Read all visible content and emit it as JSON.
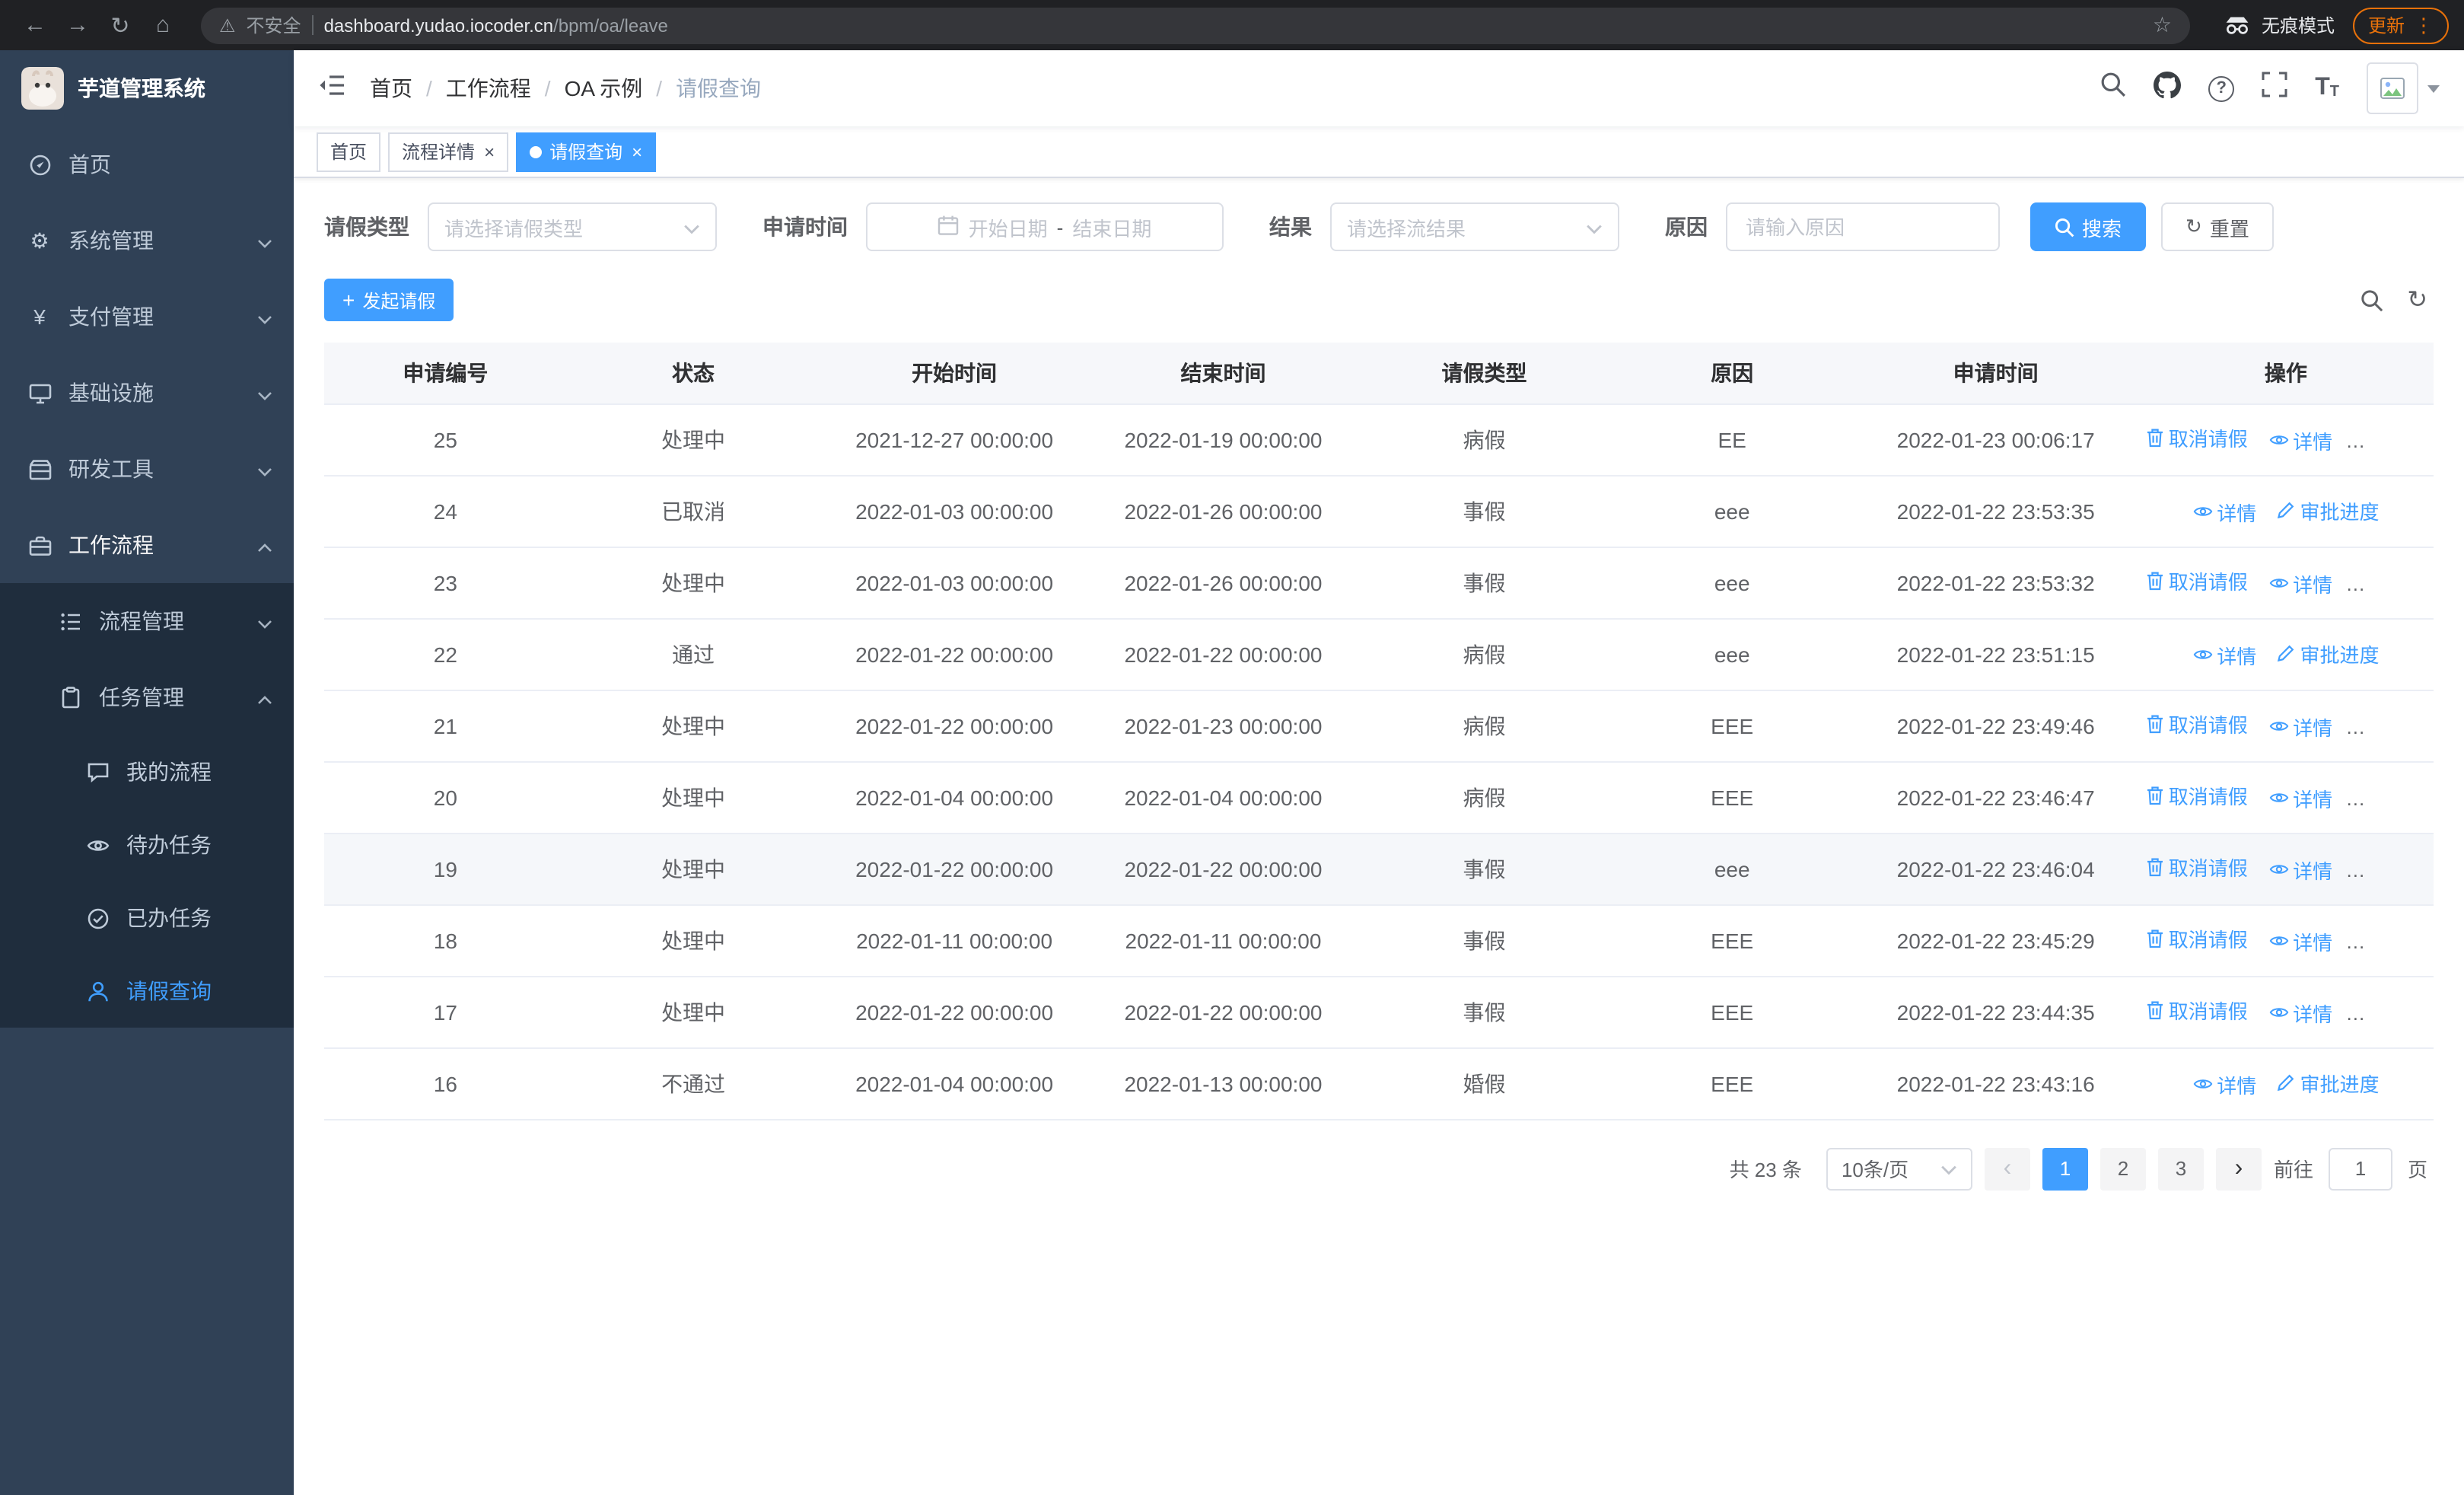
{
  "browser": {
    "security_label": "不安全",
    "url_host": "dashboard.yudao.iocoder.cn",
    "url_path": "/bpm/oa/leave",
    "incognito_label": "无痕模式",
    "update_label": "更新"
  },
  "sidebar": {
    "title": "芋道管理系统",
    "items": [
      {
        "label": "首页"
      },
      {
        "label": "系统管理"
      },
      {
        "label": "支付管理"
      },
      {
        "label": "基础设施"
      },
      {
        "label": "研发工具"
      },
      {
        "label": "工作流程"
      },
      {
        "label": "流程管理"
      },
      {
        "label": "任务管理"
      },
      {
        "label": "我的流程"
      },
      {
        "label": "待办任务"
      },
      {
        "label": "已办任务"
      },
      {
        "label": "请假查询"
      }
    ]
  },
  "breadcrumb": [
    "首页",
    "工作流程",
    "OA 示例",
    "请假查询"
  ],
  "tabs": [
    {
      "label": "首页"
    },
    {
      "label": "流程详情"
    },
    {
      "label": "请假查询"
    }
  ],
  "filter": {
    "leave_type_label": "请假类型",
    "leave_type_placeholder": "请选择请假类型",
    "apply_time_label": "申请时间",
    "start_placeholder": "开始日期",
    "separator": "-",
    "end_placeholder": "结束日期",
    "result_label": "结果",
    "result_placeholder": "请选择流结果",
    "reason_label": "原因",
    "reason_placeholder": "请输入原因",
    "search_label": "搜索",
    "reset_label": "重置"
  },
  "toolbar": {
    "create_label": "发起请假"
  },
  "table": {
    "columns": [
      "申请编号",
      "状态",
      "开始时间",
      "结束时间",
      "请假类型",
      "原因",
      "申请时间",
      "操作"
    ],
    "ops": {
      "cancel": "取消请假",
      "detail": "详情",
      "progress": "审批进度"
    },
    "rows": [
      {
        "id": "25",
        "status": "处理中",
        "start": "2021-12-27 00:00:00",
        "end": "2022-01-19 00:00:00",
        "type": "病假",
        "reason": "EE",
        "apply": "2022-01-23 00:06:17",
        "can_cancel": true,
        "highlight": false
      },
      {
        "id": "24",
        "status": "已取消",
        "start": "2022-01-03 00:00:00",
        "end": "2022-01-26 00:00:00",
        "type": "事假",
        "reason": "eee",
        "apply": "2022-01-22 23:53:35",
        "can_cancel": false,
        "highlight": false
      },
      {
        "id": "23",
        "status": "处理中",
        "start": "2022-01-03 00:00:00",
        "end": "2022-01-26 00:00:00",
        "type": "事假",
        "reason": "eee",
        "apply": "2022-01-22 23:53:32",
        "can_cancel": true,
        "highlight": false
      },
      {
        "id": "22",
        "status": "通过",
        "start": "2022-01-22 00:00:00",
        "end": "2022-01-22 00:00:00",
        "type": "病假",
        "reason": "eee",
        "apply": "2022-01-22 23:51:15",
        "can_cancel": false,
        "highlight": false
      },
      {
        "id": "21",
        "status": "处理中",
        "start": "2022-01-22 00:00:00",
        "end": "2022-01-23 00:00:00",
        "type": "病假",
        "reason": "EEE",
        "apply": "2022-01-22 23:49:46",
        "can_cancel": true,
        "highlight": false
      },
      {
        "id": "20",
        "status": "处理中",
        "start": "2022-01-04 00:00:00",
        "end": "2022-01-04 00:00:00",
        "type": "病假",
        "reason": "EEE",
        "apply": "2022-01-22 23:46:47",
        "can_cancel": true,
        "highlight": false
      },
      {
        "id": "19",
        "status": "处理中",
        "start": "2022-01-22 00:00:00",
        "end": "2022-01-22 00:00:00",
        "type": "事假",
        "reason": "eee",
        "apply": "2022-01-22 23:46:04",
        "can_cancel": true,
        "highlight": true
      },
      {
        "id": "18",
        "status": "处理中",
        "start": "2022-01-11 00:00:00",
        "end": "2022-01-11 00:00:00",
        "type": "事假",
        "reason": "EEE",
        "apply": "2022-01-22 23:45:29",
        "can_cancel": true,
        "highlight": false
      },
      {
        "id": "17",
        "status": "处理中",
        "start": "2022-01-22 00:00:00",
        "end": "2022-01-22 00:00:00",
        "type": "事假",
        "reason": "EEE",
        "apply": "2022-01-22 23:44:35",
        "can_cancel": true,
        "highlight": false
      },
      {
        "id": "16",
        "status": "不通过",
        "start": "2022-01-04 00:00:00",
        "end": "2022-01-13 00:00:00",
        "type": "婚假",
        "reason": "EEE",
        "apply": "2022-01-22 23:43:16",
        "can_cancel": false,
        "highlight": false
      }
    ]
  },
  "pagination": {
    "total": "共 23 条",
    "page_size": "10条/页",
    "pages": [
      "1",
      "2",
      "3"
    ],
    "goto_label": "前往",
    "goto_value": "1",
    "unit_label": "页"
  },
  "colors": {
    "primary": "#409EFF",
    "sidebar_bg": "#304156",
    "submenu_bg": "#1f2d3d"
  }
}
